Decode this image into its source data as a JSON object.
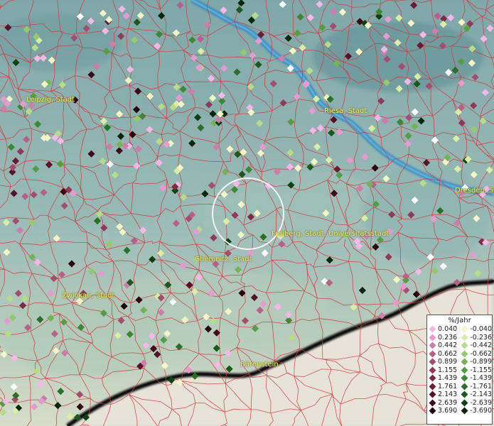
{
  "map": {
    "cities": [
      {
        "name": "Leipzig, Stadt"
      },
      {
        "name": "Riesa, Stadt"
      },
      {
        "name": "Dresden, St"
      },
      {
        "name": "Freiberg, Stadt, Universitätsstadt"
      },
      {
        "name": "Chemnitz, Stadt"
      },
      {
        "name": "Zwickau, Stadt"
      },
      {
        "name": "Bärenstein"
      }
    ],
    "colors": {
      "background": "#8fb3b3",
      "borders": "#d9363a",
      "river": "#3d8fc0",
      "label": "#f1f15a"
    }
  },
  "legend": {
    "title": "%/Jahr",
    "positive": [
      {
        "label": "0.040",
        "color": "#f4b8e8"
      },
      {
        "label": "0.236",
        "color": "#e59ad0"
      },
      {
        "label": "0.442",
        "color": "#cf7bab"
      },
      {
        "label": "0.662",
        "color": "#b86088"
      },
      {
        "label": "0.899",
        "color": "#a34d6f"
      },
      {
        "label": "1.155",
        "color": "#8f3a58"
      },
      {
        "label": "1.439",
        "color": "#7c2b46"
      },
      {
        "label": "1.761",
        "color": "#681d35"
      },
      {
        "label": "2.143",
        "color": "#541327"
      },
      {
        "label": "2.639",
        "color": "#3e0a1a"
      },
      {
        "label": "3.690",
        "color": "#27030d"
      }
    ],
    "negative": [
      {
        "label": "-0.040",
        "color": "#f3f6c4"
      },
      {
        "label": "-0.236",
        "color": "#d9eda5"
      },
      {
        "label": "-0.442",
        "color": "#b6dc86"
      },
      {
        "label": "-0.662",
        "color": "#94c96c"
      },
      {
        "label": "-0.899",
        "color": "#74b457"
      },
      {
        "label": "-1.155",
        "color": "#569d44"
      },
      {
        "label": "-1.439",
        "color": "#3e8735"
      },
      {
        "label": "-1.761",
        "color": "#2a7028"
      },
      {
        "label": "-2.143",
        "color": "#195a1c"
      },
      {
        "label": "-2.639",
        "color": "#0c4211"
      },
      {
        "label": "-3.690",
        "color": "#032807"
      }
    ]
  }
}
